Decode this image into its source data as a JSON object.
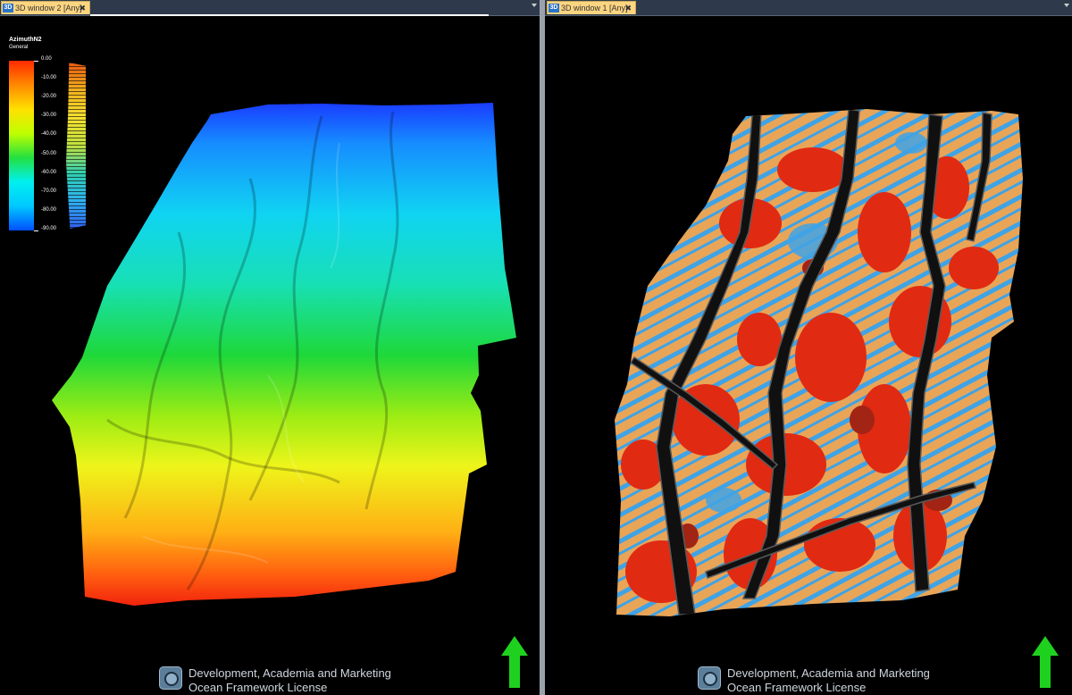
{
  "windows": {
    "left": {
      "tab_badge": "3D",
      "tab_label": "3D window 2 [Any]",
      "close_glyph": "✖",
      "legend": {
        "title": "AzimuthN2",
        "subtitle": "General",
        "ticks": [
          "0.00",
          "-10.00",
          "-20.00",
          "-30.00",
          "-40.00",
          "-50.00",
          "-60.00",
          "-70.00",
          "-80.00",
          "-90.00"
        ]
      }
    },
    "right": {
      "tab_badge": "3D",
      "tab_label": "3D window 1 [Any]",
      "close_glyph": "✖"
    }
  },
  "watermark": {
    "line1": "Development, Academia and Marketing",
    "line2": "Ocean Framework License",
    "icon": "ocean-logo-icon"
  },
  "north_arrow": {
    "icon": "north-arrow-icon",
    "color": "#1fd11f"
  },
  "colors": {
    "tab_active": "#fdd581",
    "tabstrip": "#2e3a4b",
    "surface_orange": "#e8a558",
    "surface_red": "#e12a12",
    "surface_blue": "#3fa3e6"
  }
}
